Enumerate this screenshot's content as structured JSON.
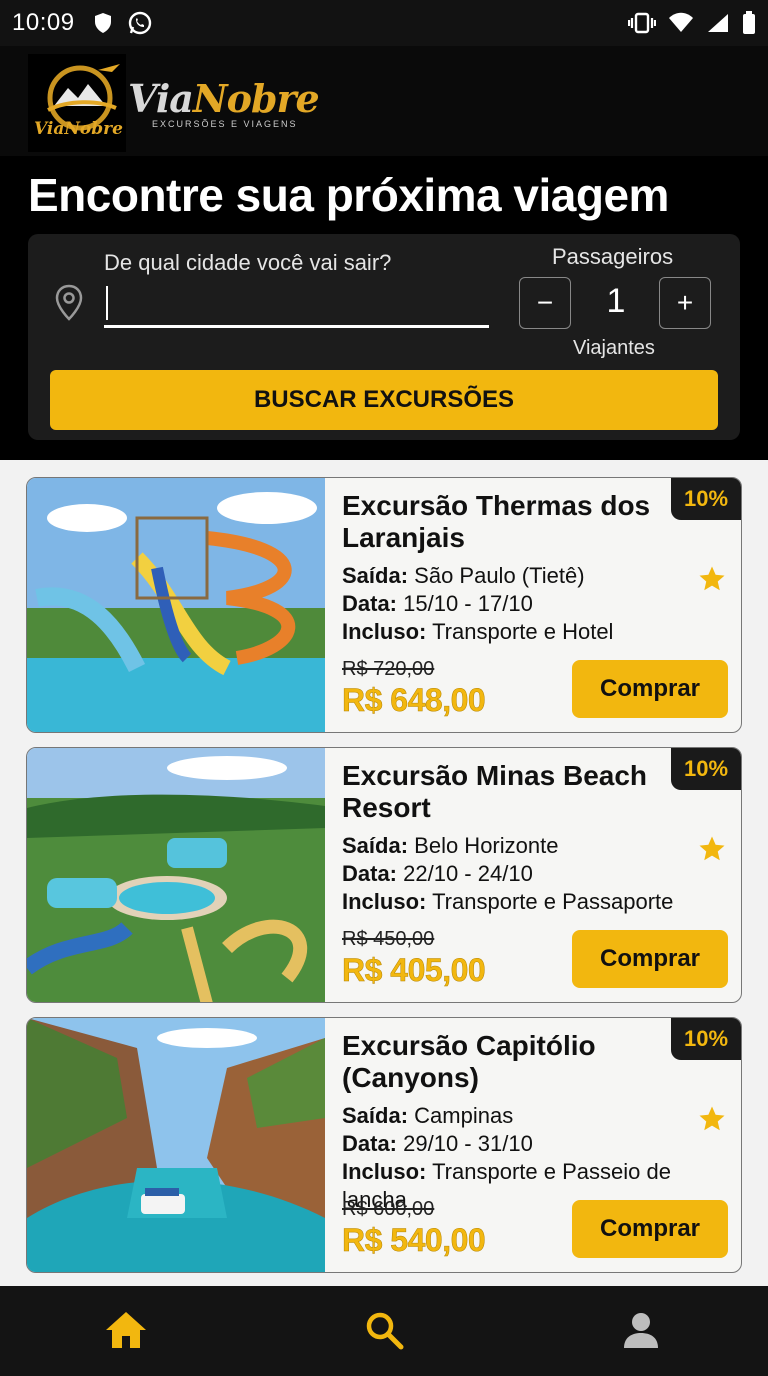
{
  "status_bar": {
    "time": "10:09"
  },
  "header": {
    "logo_emblem_text": "ViaNobre",
    "brand_part1": "Via",
    "brand_part2": "Nobre",
    "tagline": "EXCURSÕES E VIAGENS"
  },
  "hero": {
    "title": "Encontre sua próxima viagem",
    "origin_label": "De qual cidade você vai sair?",
    "origin_value": "",
    "passengers_label": "Passageiros",
    "passengers_count": "1",
    "minus_label": "−",
    "plus_label": "+",
    "travelers_label": "Viajantes",
    "search_button": "BUSCAR EXCURSÕES"
  },
  "labels": {
    "saida": "Saída:",
    "data": "Data:",
    "incluso": "Incluso:"
  },
  "trips": [
    {
      "title": "Excursão Thermas dos Laranjais",
      "discount": "10%",
      "departure": "São Paulo (Tietê)",
      "dates": "15/10 - 17/10",
      "included": "Transporte e Hotel",
      "old_price": "R$ 720,00",
      "price": "R$ 648,00",
      "buy_label": "Comprar"
    },
    {
      "title": "Excursão Minas Beach Resort",
      "discount": "10%",
      "departure": "Belo Horizonte",
      "dates": "22/10 - 24/10",
      "included": "Transporte e Passaporte",
      "old_price": "R$ 450,00",
      "price": "R$ 405,00",
      "buy_label": "Comprar"
    },
    {
      "title": "Excursão Capitólio (Canyons)",
      "discount": "10%",
      "departure": "Campinas",
      "dates": "29/10 - 31/10",
      "included": "Transporte e Passeio de lancha",
      "old_price": "R$ 600,00",
      "price": "R$ 540,00",
      "buy_label": "Comprar"
    }
  ],
  "colors": {
    "accent": "#f2b70f",
    "dark": "#000000",
    "card_bg": "#f6f6f4"
  },
  "bottom_nav": {
    "items": [
      "home-icon",
      "search-icon",
      "profile-icon"
    ]
  }
}
